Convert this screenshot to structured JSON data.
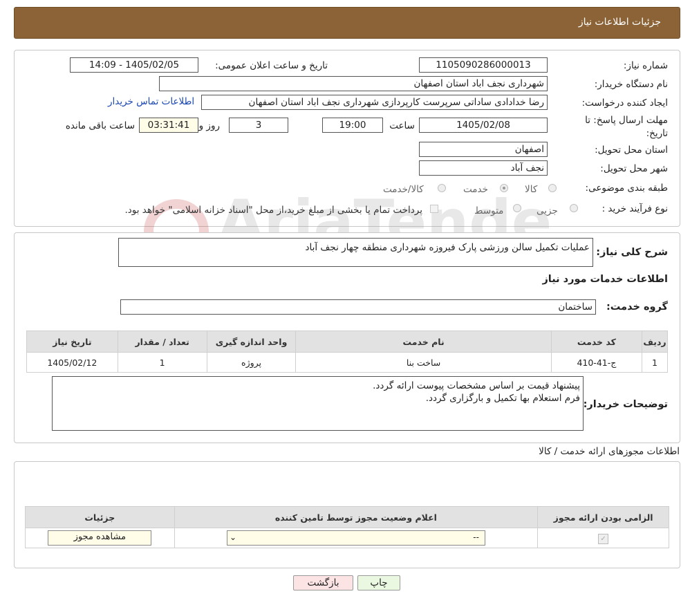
{
  "header": {
    "title": "جزئیات اطلاعات نیاز"
  },
  "form": {
    "need_number_label": "شماره نیاز:",
    "need_number": "1105090286000013",
    "announce_label": "تاریخ و ساعت اعلان عمومی:",
    "announce_value": "1405/02/05 - 14:09",
    "buyer_org_label": "نام دستگاه خریدار:",
    "buyer_org": "شهرداری نجف اباد استان اصفهان",
    "creator_label": "ایجاد کننده درخواست:",
    "creator": "رضا خدادادی ساداتی سرپرست  کارپردازی شهرداری نجف اباد استان اصفهان",
    "contact_link": "اطلاعات تماس خریدار",
    "deadline_label": "مهلت ارسال پاسخ: تا تاریخ:",
    "deadline_date": "1405/02/08",
    "time_label": "ساعت",
    "deadline_time": "19:00",
    "days": "3",
    "days_label": "روز و",
    "remaining": "03:31:41",
    "remaining_label": "ساعت باقی مانده",
    "province_label": "استان محل تحویل:",
    "province": "اصفهان",
    "city_label": "شهر محل تحویل:",
    "city": "نجف آباد",
    "category_label": "طبقه بندی موضوعی:",
    "category_options": [
      "کالا",
      "خدمت",
      "کالا/خدمت"
    ],
    "category_selected": "خدمت",
    "purchase_type_label": "نوع فرآیند خرید :",
    "purchase_options": [
      "جزیی",
      "متوسط"
    ],
    "purchase_note": "پرداخت تمام یا بخشی از مبلغ خرید،از محل \"اسناد خزانه اسلامی\" خواهد بود."
  },
  "desc": {
    "label": "شرح کلی نیاز:",
    "value": "عملیات تکمیل سالن ورزشی پارک فیروزه شهرداری منطقه چهار نجف آباد",
    "services_title": "اطلاعات خدمات مورد نیاز",
    "group_label": "گروه خدمت:",
    "group_value": "ساختمان"
  },
  "services_table": {
    "headers": [
      "ردیف",
      "کد خدمت",
      "نام خدمت",
      "واحد اندازه گیری",
      "تعداد / مقدار",
      "تاریخ نیاز"
    ],
    "rows": [
      [
        "1",
        "ج-41-410",
        "ساخت بنا",
        "پروژه",
        "1",
        "1405/02/12"
      ]
    ]
  },
  "buyer_notes": {
    "label": "توضیحات خریدار:",
    "line1": "پیشنهاد قیمت بر اساس مشخصات پیوست ارائه گردد.",
    "line2": "فرم استعلام بها تکمیل و بارگزاری گردد."
  },
  "permits": {
    "title": "اطلاعات مجوزهای ارائه خدمت / کالا",
    "headers": [
      "الزامی بودن ارائه مجوز",
      "اعلام وضعیت مجوز توسط تامین کننده",
      "جزئیات"
    ],
    "select_value": "--",
    "view_button": "مشاهده مجوز"
  },
  "footer": {
    "back_button": "بازگشت",
    "print_button": "چاپ"
  },
  "watermark": {
    "text": "AriaTender.neT"
  }
}
